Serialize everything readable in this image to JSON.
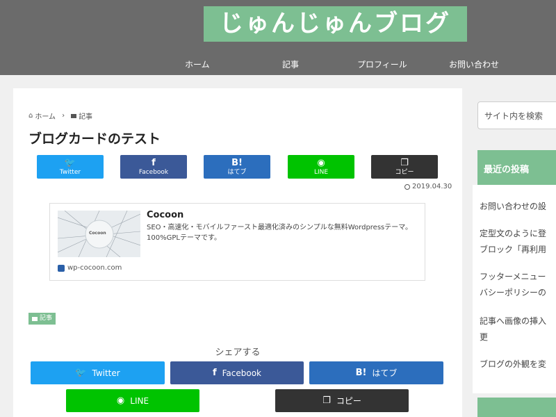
{
  "header": {
    "site_title": "じゅんじゅんブログ",
    "nav": [
      "ホーム",
      "記事",
      "プロフィール",
      "お問い合わせ"
    ]
  },
  "breadcrumb": {
    "home": "ホーム",
    "separator": "›",
    "category": "記事"
  },
  "article": {
    "title": "ブログカードのテスト",
    "date": "2019.04.30",
    "category_tag": "記事"
  },
  "share_top": [
    {
      "icon": "twitter-icon",
      "glyph": "🐦",
      "label": "Twitter",
      "color": "#1da1f2"
    },
    {
      "icon": "facebook-icon",
      "glyph": "f",
      "label": "Facebook",
      "color": "#3b5998"
    },
    {
      "icon": "hatena-icon",
      "glyph": "B!",
      "label": "はてブ",
      "color": "#2c6ebd"
    },
    {
      "icon": "line-icon",
      "glyph": "◉",
      "label": "LINE",
      "color": "#00c300"
    },
    {
      "icon": "copy-icon",
      "glyph": "❐",
      "label": "コピー",
      "color": "#333333"
    }
  ],
  "blog_card": {
    "title": "Cocoon",
    "description": "SEO・高速化・モバイルファースト最適化済みのシンプルな無料Wordpressテーマ。100%GPLテーマです。",
    "site": "wp-cocoon.com",
    "thumb_text": "Cocoon"
  },
  "share_bottom": {
    "heading": "シェアする",
    "buttons": [
      {
        "icon": "twitter-icon",
        "glyph": "🐦",
        "label": "Twitter"
      },
      {
        "icon": "facebook-icon",
        "glyph": "f",
        "label": "Facebook"
      },
      {
        "icon": "hatena-icon",
        "glyph": "B!",
        "label": "はてブ"
      },
      {
        "icon": "line-icon",
        "glyph": "◉",
        "label": "LINE"
      },
      {
        "icon": "copy-icon",
        "glyph": "❐",
        "label": "コピー"
      }
    ]
  },
  "sidebar": {
    "search_placeholder": "サイト内を検索",
    "recent_heading": "最近の投稿",
    "recent_items": [
      "お問い合わせの設",
      "定型文のように登",
      "ブロック「再利用",
      "フッターメニュー",
      "バシーポリシーの",
      "記事へ画像の挿入",
      "更",
      "ブログの外観を変"
    ]
  },
  "colors": {
    "accent": "#7dbf92",
    "header_bg": "#6b6b6b"
  }
}
